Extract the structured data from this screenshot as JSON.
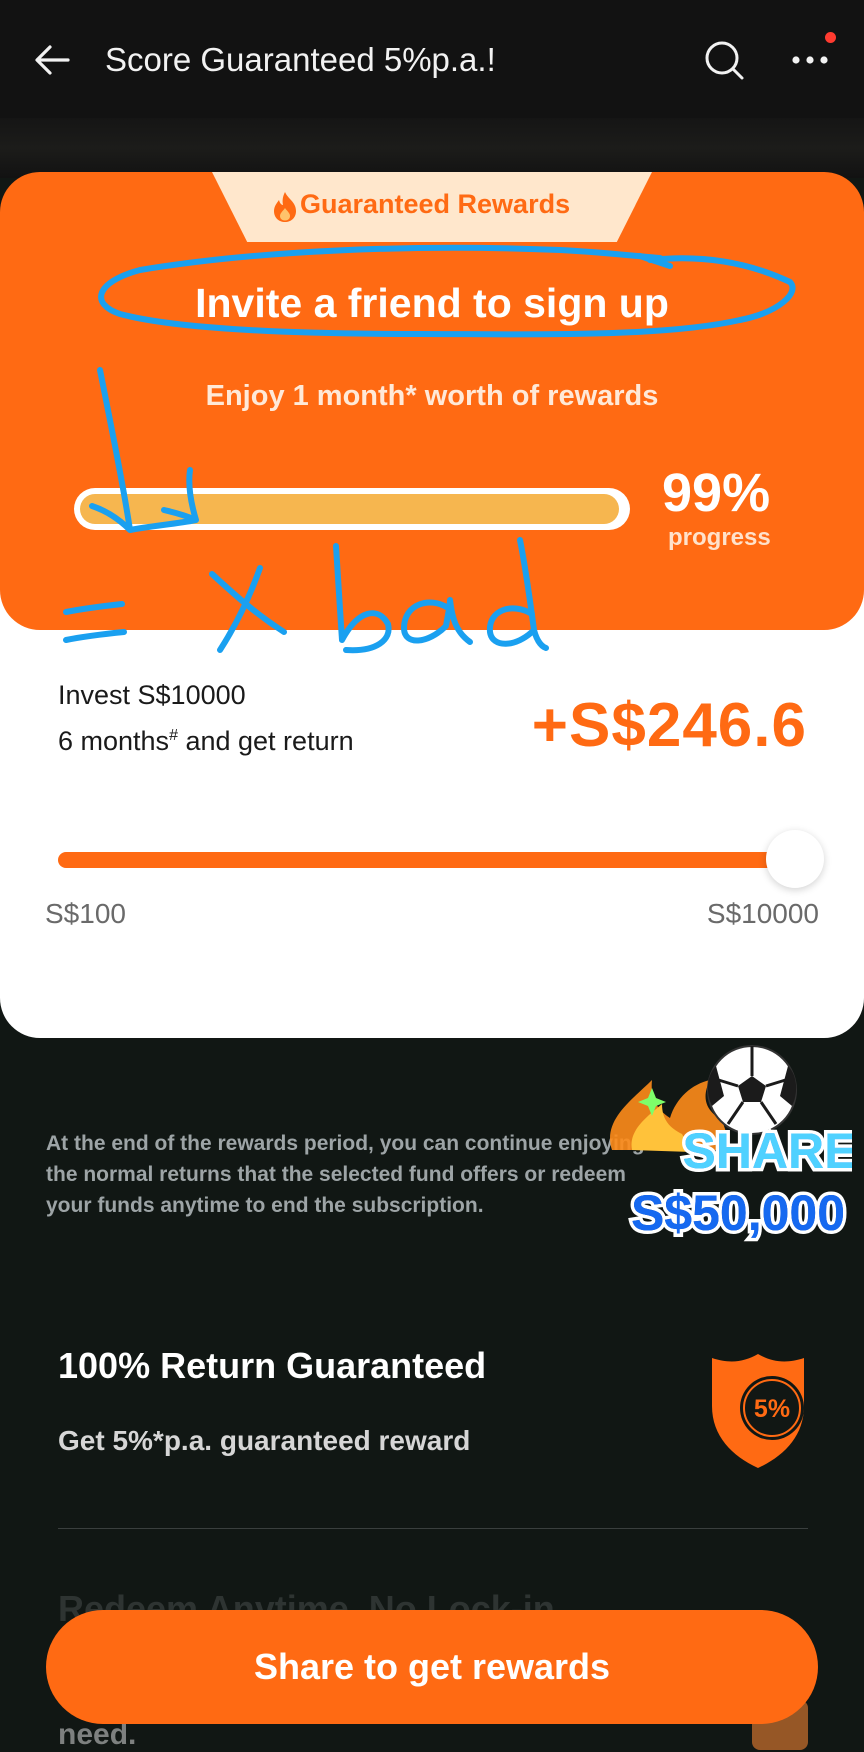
{
  "header": {
    "title": "Score Guaranteed 5%p.a.!",
    "back_icon": "arrow-left-icon",
    "search_icon": "search-icon",
    "more_icon": "more-horizontal-icon",
    "notification_dot_color": "#ff3b30"
  },
  "rewards_card": {
    "tab_label": "Guaranteed Rewards",
    "tab_icon": "flame-icon",
    "headline": "Invite a friend to sign up",
    "subline": "Enjoy 1 month* worth of rewards",
    "progress_percent_text": "99%",
    "progress_label": "progress",
    "progress_value": 0.99
  },
  "calculator": {
    "invest_line1": "Invest S$10000",
    "invest_line2": "6 months",
    "invest_line2_sup": "#",
    "invest_line2_rest": " and get return",
    "return_amount": "+S$246.6",
    "slider_min": "S$100",
    "slider_max": "S$10000",
    "slider_value": 1.0
  },
  "annotation": {
    "text": "= x bad"
  },
  "info": {
    "text": "At the end of the rewards period, you can continue enjoying the normal returns that the selected fund offers or redeem your funds anytime to end the subscription."
  },
  "share_badge": {
    "line1": "SHARE",
    "line2": "S$50,000",
    "icon": "soccer-ball-icon"
  },
  "guarantee": {
    "title": "100% Return Guaranteed",
    "subtitle": "Get 5%*p.a. guaranteed reward",
    "badge_text": "5%",
    "badge_icon": "shield-icon"
  },
  "bottom": {
    "peek_text": "Redeem Anytime, No Lock-in",
    "peek_text2": "need.",
    "share_button_label": "Share to get rewards"
  },
  "colors": {
    "brand_orange": "#ff6a13",
    "background": "#111714",
    "annotation_blue": "#1aa0f0"
  }
}
